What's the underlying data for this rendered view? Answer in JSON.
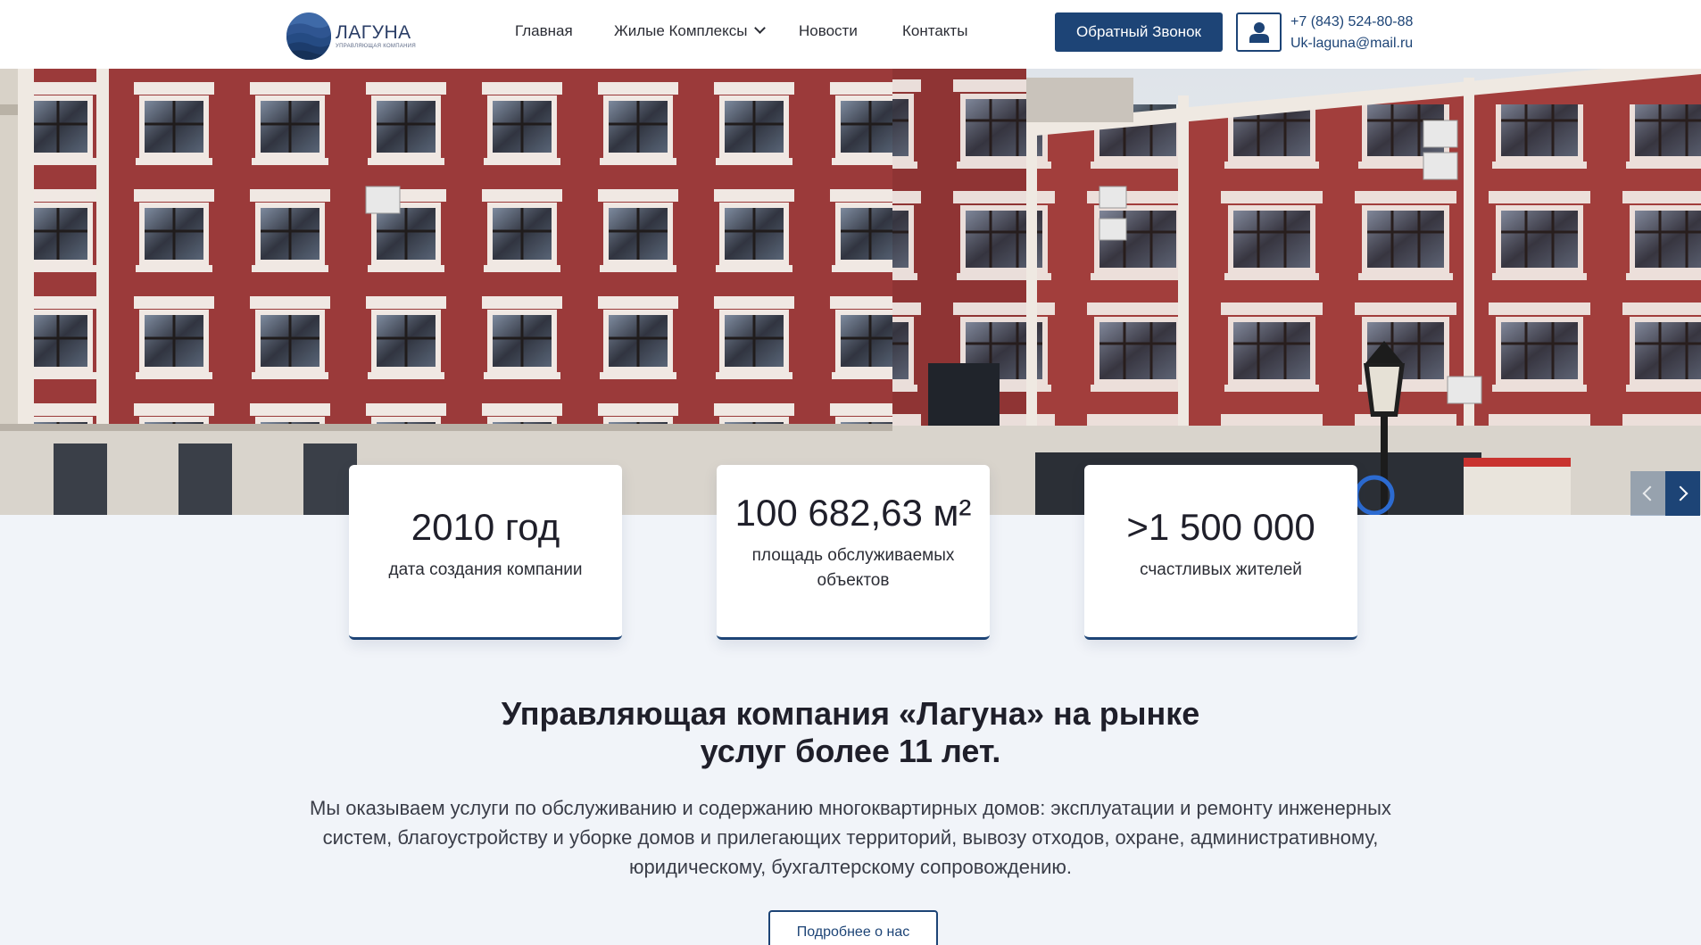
{
  "header": {
    "logo": {
      "name": "ЛАГУНА",
      "subtitle": "управляющая компания"
    },
    "nav": [
      {
        "label": "Главная"
      },
      {
        "label": "Жилые Комплексы"
      },
      {
        "label": "Новости"
      },
      {
        "label": "Контакты"
      }
    ],
    "callback_label": "Обратный Звонок",
    "phone": "+7 (843) 524-80-88",
    "email": "Uk-laguna@mail.ru"
  },
  "hero": {
    "slider": {
      "prev_icon": "chevron-left-icon",
      "next_icon": "chevron-right-icon"
    }
  },
  "stats": [
    {
      "value": "2010 год",
      "label": "дата создания компании"
    },
    {
      "value": "100 682,63 м²",
      "label": "площадь обслуживаемых объектов"
    },
    {
      "value": ">1 500 000",
      "label": "счастливых жителей"
    }
  ],
  "about": {
    "title": "Управляющая компания «Лагуна» на рынке услуг более 11 лет.",
    "text": "Мы оказываем услуги по обслуживанию и содержанию многоквартирных домов: эксплуатации и ремонту инженерных систем, благоустройству и уборке домов и прилегающих территорий, вывозу отходов, охране, административному, юридическому, бухгалтерскому сопровождению.",
    "more_label": "Подробнее о нас"
  },
  "colors": {
    "accent": "#1d4476",
    "background": "#f1f4f9",
    "facade": "#9b3a3a"
  }
}
